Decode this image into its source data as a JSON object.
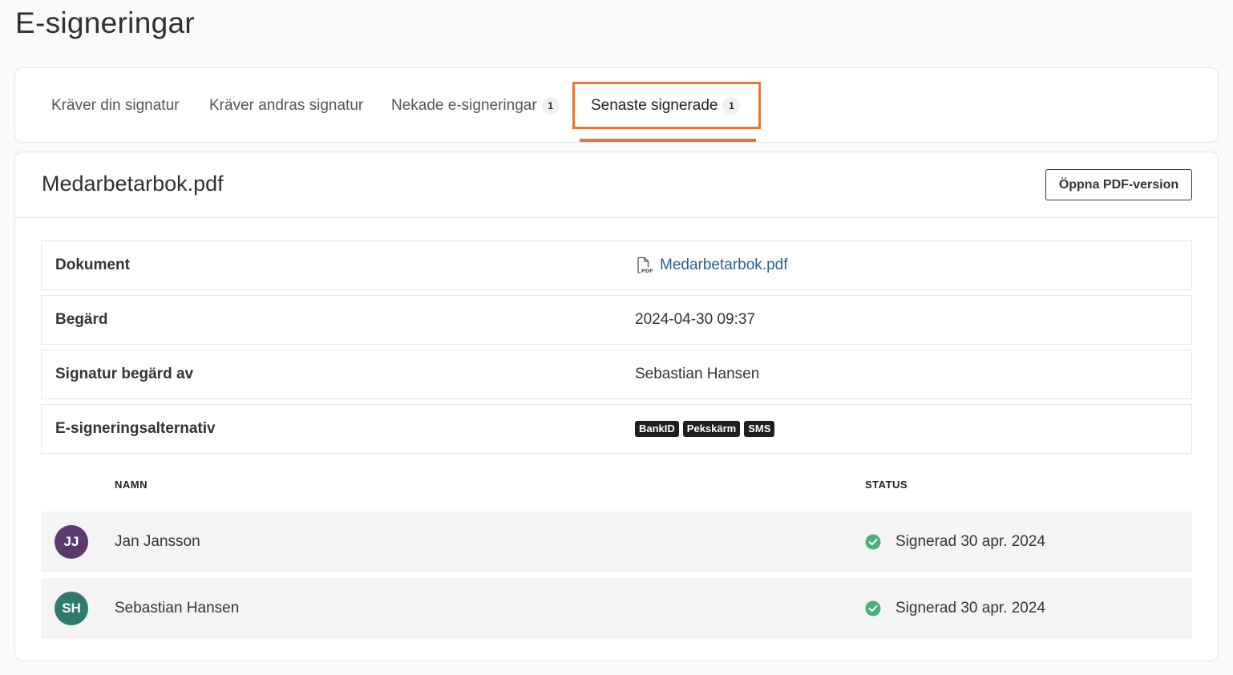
{
  "page": {
    "title": "E-signeringar"
  },
  "tabs": [
    {
      "label": "Kräver din signatur",
      "count": ""
    },
    {
      "label": "Kräver andras signatur",
      "count": ""
    },
    {
      "label": "Nekade e-signeringar",
      "count": "1"
    },
    {
      "label": "Senaste signerade",
      "count": "1",
      "active": true
    }
  ],
  "colors": {
    "accent": "#e07a3a",
    "link": "#2b5f8a",
    "success": "#4caf7a"
  },
  "document": {
    "title": "Medarbetarbok.pdf",
    "open_pdf_label": "Öppna PDF-version",
    "rows": {
      "document": {
        "label": "Dokument",
        "value": "Medarbetarbok.pdf",
        "icon": "pdf-file-icon"
      },
      "requested": {
        "label": "Begärd",
        "value": "2024-04-30 09:37"
      },
      "requested_by": {
        "label": "Signatur begärd av",
        "value": "Sebastian Hansen"
      },
      "methods": {
        "label": "E-signeringsalternativ",
        "tags": [
          "BankID",
          "Pekskärm",
          "SMS"
        ]
      }
    }
  },
  "signers": {
    "headers": {
      "name": "NAMN",
      "status": "STATUS"
    },
    "rows": [
      {
        "initials": "JJ",
        "name": "Jan Jansson",
        "status": "Signerad 30 apr. 2024",
        "avatar_color": "#5b3a6e",
        "status_icon": "check-circle-icon"
      },
      {
        "initials": "SH",
        "name": "Sebastian Hansen",
        "status": "Signerad 30 apr. 2024",
        "avatar_color": "#2f7a6e",
        "status_icon": "check-circle-icon"
      }
    ]
  }
}
